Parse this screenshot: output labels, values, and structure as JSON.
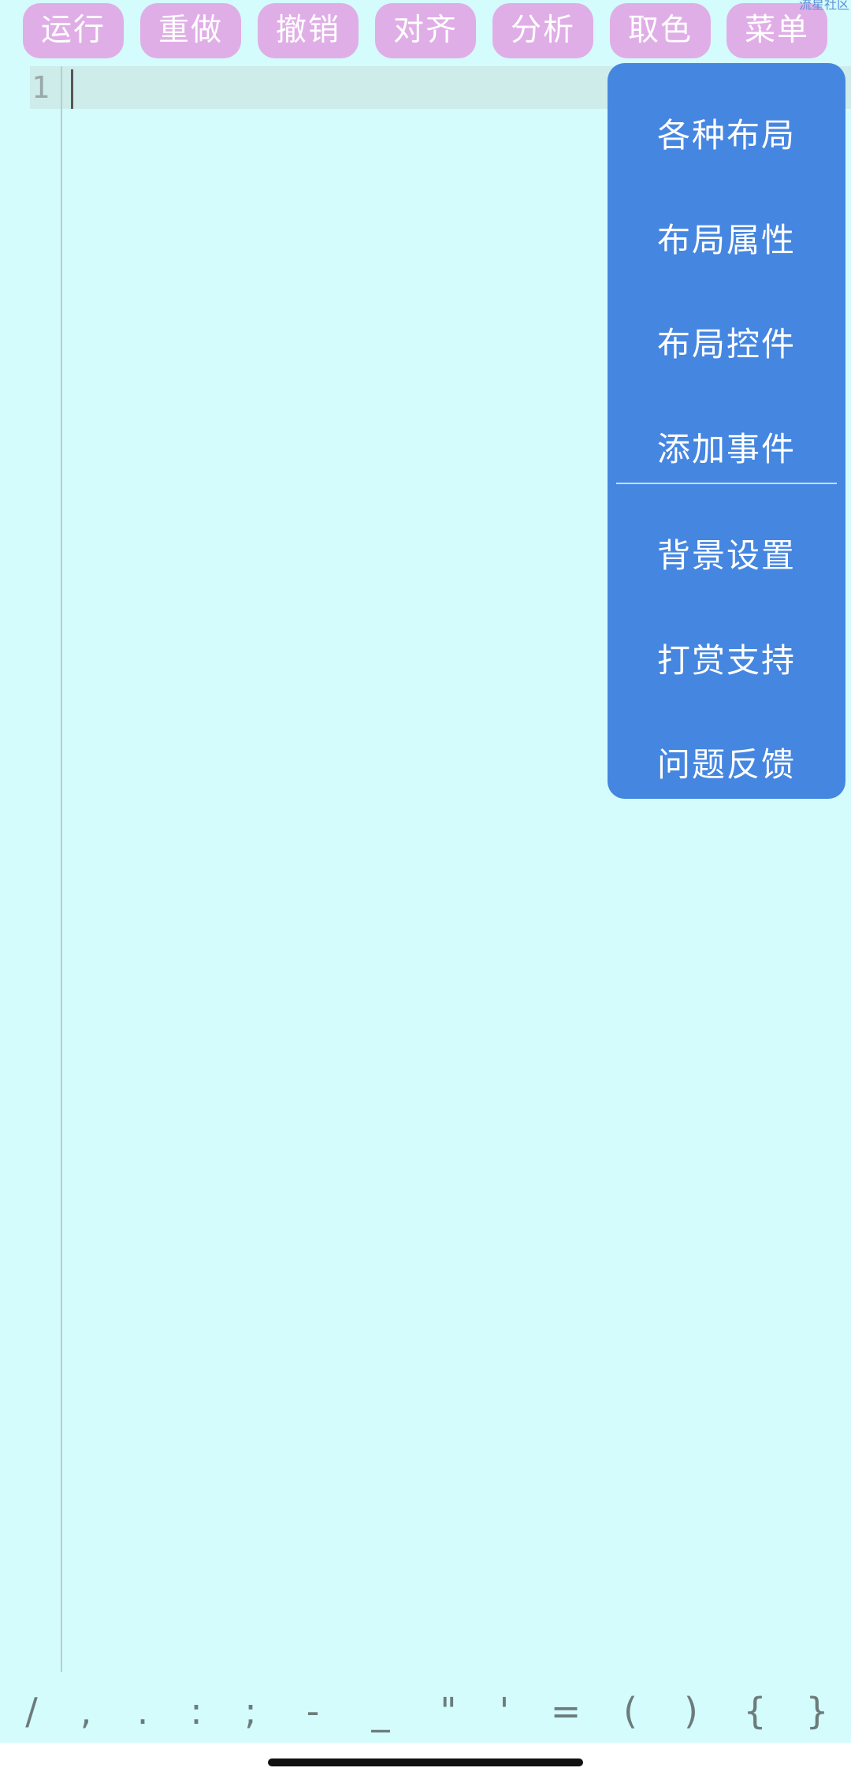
{
  "toolbar": {
    "run_label": "运行",
    "redo_label": "重做",
    "undo_label": "撤销",
    "align_label": "对齐",
    "analyze_label": "分析",
    "color_pick_label": "取色",
    "menu_label": "菜单"
  },
  "watermark": "流星社区",
  "editor": {
    "line_number": "1"
  },
  "menu": {
    "items": [
      "各种布局",
      "布局属性",
      "布局控件",
      "添加事件",
      "背景设置",
      "打赏支持",
      "问题反馈"
    ]
  },
  "symbols": [
    "/",
    ",",
    ".",
    ":",
    ";",
    "-",
    "_",
    "\"",
    "'",
    "=",
    "(",
    ")",
    "{",
    "}"
  ],
  "colors": {
    "background": "#d4fcfc",
    "toolbar_button": "#e0aee6",
    "menu_background": "#4586e1",
    "current_line": "#cdecea"
  }
}
